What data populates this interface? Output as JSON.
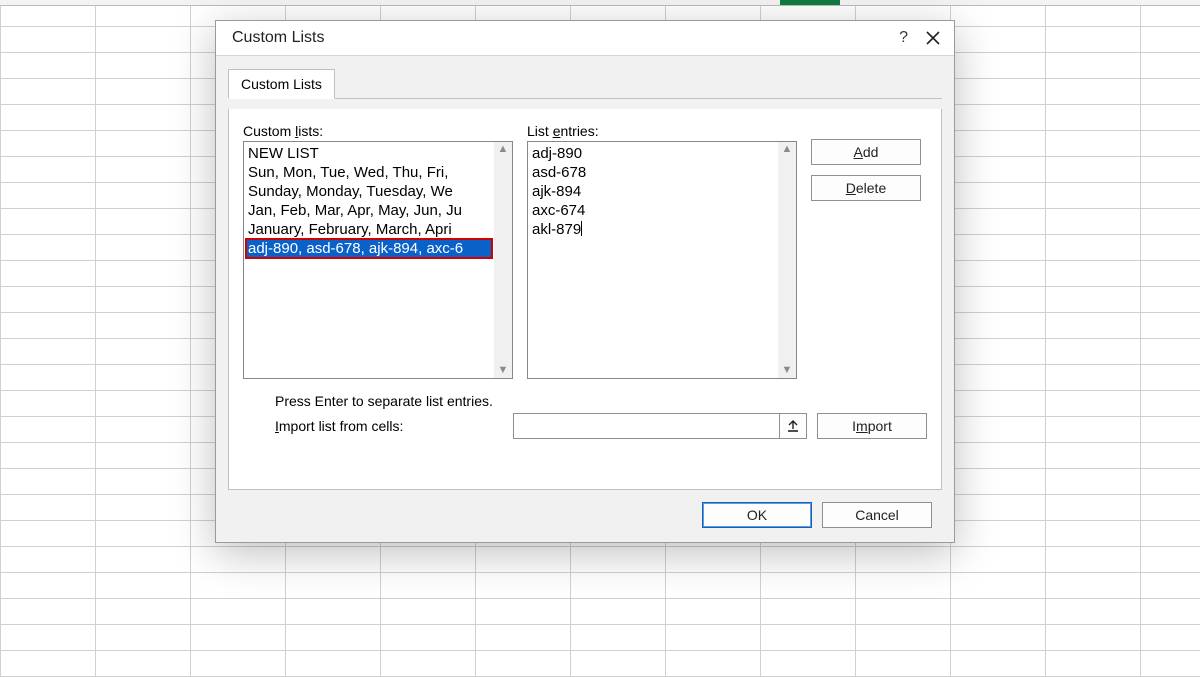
{
  "dialog": {
    "title": "Custom Lists",
    "help_label": "?",
    "tab": "Custom Lists",
    "custom_lists_label": "Custom lists:",
    "list_entries_label": "List entries:",
    "hint": "Press Enter to separate list entries.",
    "import_label": "Import list from cells:",
    "import_value": "",
    "buttons": {
      "add": "Add",
      "delete": "Delete",
      "import": "Import",
      "ok": "OK",
      "cancel": "Cancel"
    }
  },
  "custom_lists": [
    "NEW LIST",
    "Sun, Mon, Tue, Wed, Thu, Fri,",
    "Sunday, Monday, Tuesday, We",
    "Jan, Feb, Mar, Apr, May, Jun, Ju",
    "January, February, March, Apri",
    "adj-890, asd-678, ajk-894, axc-6"
  ],
  "selected_index": 5,
  "list_entries": [
    "adj-890",
    "asd-678",
    "ajk-894",
    "axc-674",
    "akl-879"
  ]
}
